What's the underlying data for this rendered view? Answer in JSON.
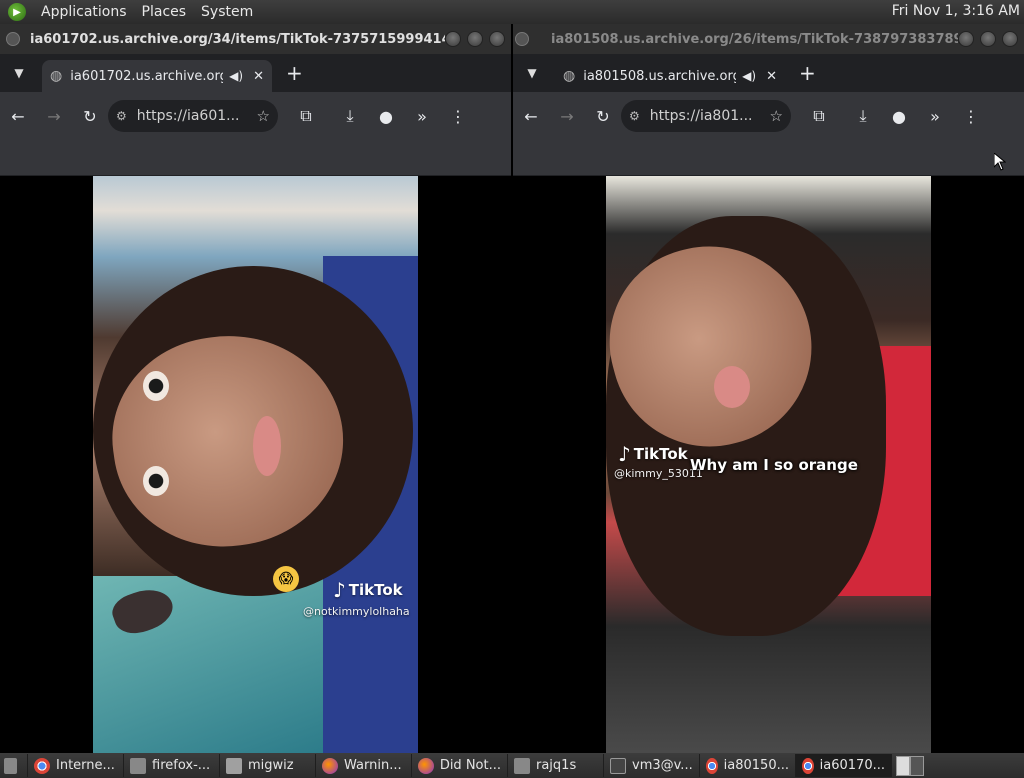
{
  "top_panel": {
    "menus": [
      "Applications",
      "Places",
      "System"
    ],
    "clock": "Fri Nov 1,  3:16 AM"
  },
  "left_window": {
    "title": "ia601702.us.archive.org/34/items/TikTok-737571599941430...",
    "tab_title": "ia601702.us.archive.org/3",
    "url": "https://ia601...",
    "video": {
      "tiktok_label": "TikTok",
      "handle": "@notkimmylolhaha",
      "emoji": "😱"
    }
  },
  "right_window": {
    "title": "ia801508.us.archive.org/26/items/TikTok-738797383789324...",
    "tab_title": "ia801508.us.archive.org/",
    "url": "https://ia801...",
    "video": {
      "tiktok_label": "TikTok",
      "handle": "@kimmy_53011",
      "caption": "Why am I so orange"
    }
  },
  "taskbar": {
    "items": [
      {
        "label": "Interne...",
        "icon": "chrome"
      },
      {
        "label": "firefox-...",
        "icon": "generic"
      },
      {
        "label": "migwiz",
        "icon": "folder"
      },
      {
        "label": "Warnin...",
        "icon": "firefox"
      },
      {
        "label": "Did Not...",
        "icon": "firefox"
      },
      {
        "label": "rajq1s",
        "icon": "generic"
      },
      {
        "label": "vm3@v...",
        "icon": "terminal"
      },
      {
        "label": "ia80150...",
        "icon": "chrome"
      },
      {
        "label": "ia60170...",
        "icon": "chrome"
      }
    ]
  },
  "colors": {
    "panel_bg": "#2b2b2b",
    "browser_toolbar": "#35363a",
    "browser_tabstrip": "#202124"
  }
}
